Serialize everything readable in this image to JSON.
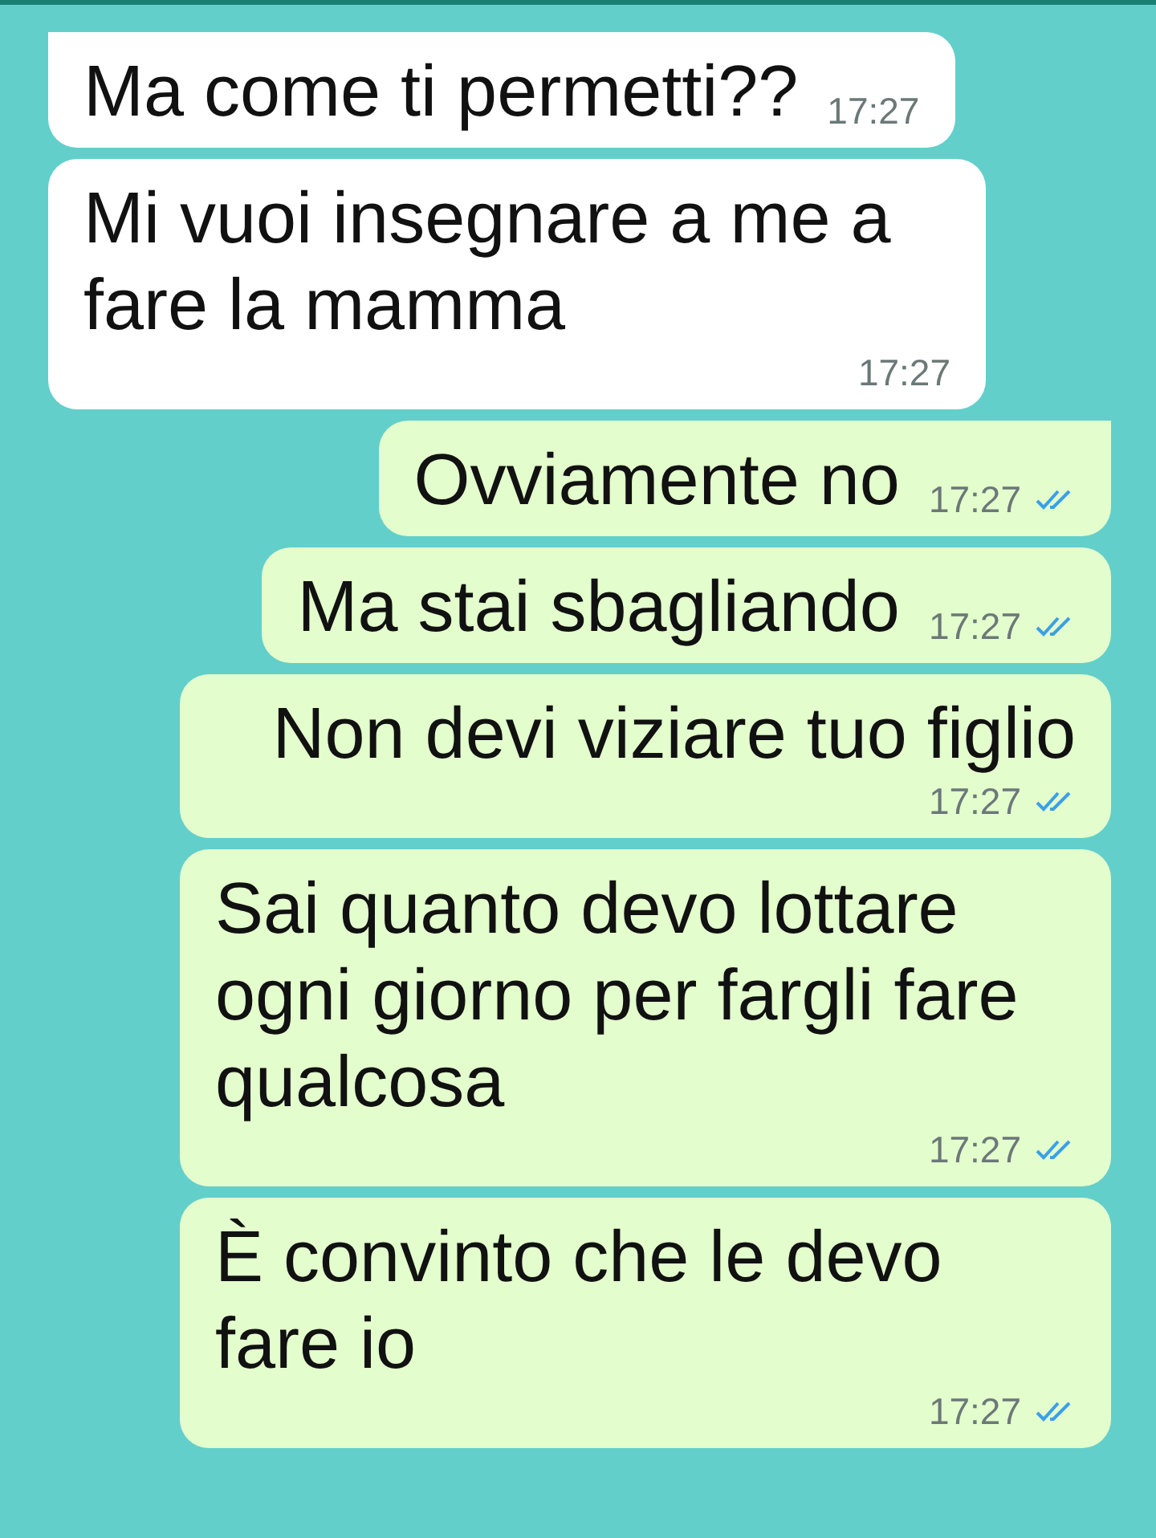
{
  "messages": [
    {
      "kind": "incoming",
      "tail": true,
      "text": "Ma come ti permetti??",
      "time": "17:27"
    },
    {
      "kind": "incoming",
      "tail": false,
      "text": "Mi vuoi insegnare a me a fare la mamma",
      "time": "17:27"
    },
    {
      "kind": "outgoing",
      "tail": true,
      "text": "Ovviamente no",
      "time": "17:27",
      "read": true
    },
    {
      "kind": "outgoing",
      "tail": false,
      "text": "Ma stai sbagliando",
      "time": "17:27",
      "read": true
    },
    {
      "kind": "outgoing",
      "tail": false,
      "text": "Non devi viziare tuo figlio",
      "time": "17:27",
      "read": true
    },
    {
      "kind": "outgoing",
      "tail": false,
      "text": "Sai quanto devo lottare ogni giorno per fargli fare qualcosa",
      "time": "17:27",
      "read": true
    },
    {
      "kind": "outgoing",
      "tail": false,
      "text": "È convinto che le devo fare io",
      "time": "17:27",
      "read": true
    }
  ]
}
